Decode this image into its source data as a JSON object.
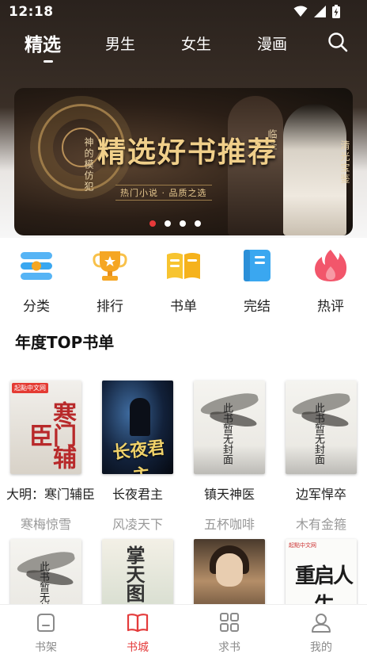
{
  "status_bar": {
    "time": "12:18"
  },
  "nav": {
    "tabs": [
      {
        "label": "精选",
        "active": true
      },
      {
        "label": "男生",
        "active": false
      },
      {
        "label": "女生",
        "active": false
      },
      {
        "label": "漫画",
        "active": false
      }
    ],
    "search_icon": "search-icon"
  },
  "banner": {
    "title": "精选好书推荐",
    "subtitle": "热门小说 · 品质之选",
    "vertical_text_left": "神的模仿犯",
    "vertical_text_mid": "临圣",
    "vertical_text_right": "清光宝鉴",
    "dots": 4,
    "active_dot": 0
  },
  "categories": [
    {
      "label": "分类",
      "icon": "category-list-icon",
      "color": "#3aa7f0"
    },
    {
      "label": "排行",
      "icon": "trophy-icon",
      "color": "#f5a623"
    },
    {
      "label": "书单",
      "icon": "open-book-icon",
      "color": "#f7c430"
    },
    {
      "label": "完结",
      "icon": "closed-book-icon",
      "color": "#3aa7f0"
    },
    {
      "label": "热评",
      "icon": "flame-icon",
      "color": "#f2566b"
    }
  ],
  "section": {
    "title": "年度TOP书单"
  },
  "books_row1": [
    {
      "title": "大明：寒门辅臣",
      "author": "寒梅惊雪",
      "cover_text": "寒门辅臣",
      "cover_badge": "起點中文网"
    },
    {
      "title": "长夜君主",
      "author": "风凌天下",
      "cover_text": "长夜君主"
    },
    {
      "title": "镇天神医",
      "author": "五杯咖啡",
      "cover_text": "此书暂无封面"
    },
    {
      "title": "边军悍卒",
      "author": "木有金箍",
      "cover_text": "此书暂无封面"
    }
  ],
  "books_row2": [
    {
      "cover_text": "此书暂无封面"
    },
    {
      "cover_text": "掌天图"
    },
    {
      "cover_text": ""
    },
    {
      "cover_text": "重启人生",
      "cover_badge": "起點中文网"
    }
  ],
  "tabbar": {
    "items": [
      {
        "label": "书架",
        "icon": "bookshelf-icon",
        "active": false
      },
      {
        "label": "书城",
        "icon": "book-city-icon",
        "active": true
      },
      {
        "label": "求书",
        "icon": "grid-icon",
        "active": false
      },
      {
        "label": "我的",
        "icon": "profile-icon",
        "active": false
      }
    ],
    "active_color": "#e43b3b",
    "inactive_color": "#8a8a8a"
  }
}
